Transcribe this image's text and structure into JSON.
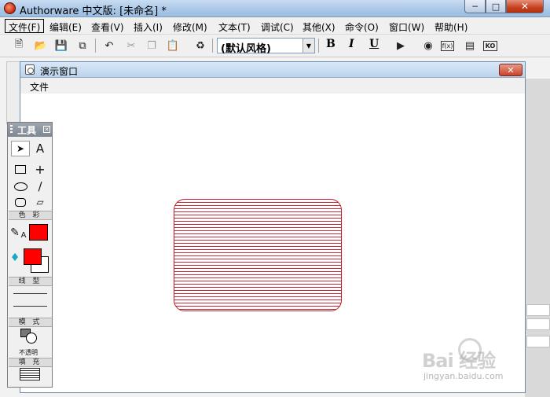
{
  "app": {
    "title": "Authorware 中文版: [未命名] *"
  },
  "menubar": {
    "items": [
      "文件(F)",
      "编辑(E)",
      "查看(V)",
      "插入(I)",
      "修改(M)",
      "文本(T)",
      "调试(C)",
      "其他(X)",
      "命令(O)",
      "窗口(W)",
      "帮助(H)"
    ]
  },
  "toolbar": {
    "style_select": "(默认风格)",
    "bold": "B",
    "italic": "I",
    "underline": "U",
    "func_label": "f(x)",
    "ko_label": "KO"
  },
  "presentation_window": {
    "title": "演示窗口",
    "menu_file": "文件",
    "shape": {
      "type": "rounded-rectangle",
      "stroke_color": "#c11d2a",
      "fill_pattern": "horizontal-lines",
      "fill_color": "#c72a36"
    }
  },
  "tools_panel": {
    "title": "工具",
    "sections": {
      "color": "色 彩",
      "line": "线 型",
      "mode": "模 式",
      "fill": "填 充"
    },
    "mode_caption": "不透明",
    "line_color": "#ff0000",
    "fill_fg_color": "#ff0000",
    "fill_bg_color": "#ffffff"
  },
  "watermark": {
    "logo": "Bai 经验",
    "url": "jingyan.baidu.com"
  }
}
